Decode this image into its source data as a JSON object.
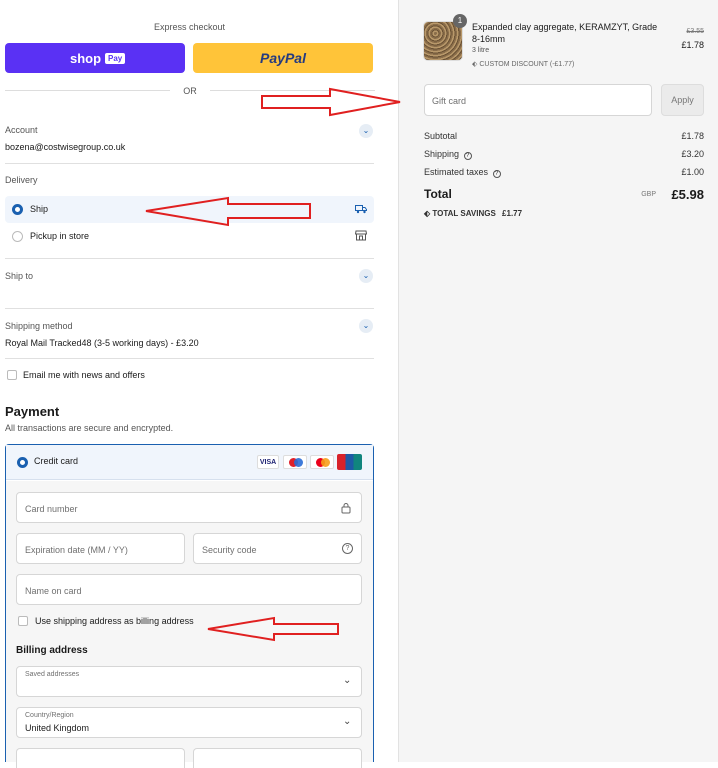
{
  "express": {
    "title": "Express checkout",
    "shop_label": "shop",
    "shop_badge": "Pay",
    "paypal_label": "PayPal",
    "or": "OR"
  },
  "account": {
    "label": "Account",
    "email": "bozena@costwisegroup.co.uk"
  },
  "delivery": {
    "label": "Delivery",
    "options": [
      {
        "label": "Ship",
        "selected": true
      },
      {
        "label": "Pickup in store",
        "selected": false
      }
    ]
  },
  "ship_to": {
    "label": "Ship to"
  },
  "shipping_method": {
    "label": "Shipping method",
    "value": "Royal Mail Tracked48 (3-5 working days) - £3.20"
  },
  "newsletter": {
    "label": "Email me with news and offers"
  },
  "payment": {
    "title": "Payment",
    "subtitle": "All transactions are secure and encrypted.",
    "method": "Credit card",
    "card_brands": [
      "VISA",
      "Maestro",
      "Mastercard",
      "UnionPay"
    ],
    "card_number_ph": "Card number",
    "expiry_ph": "Expiration date (MM / YY)",
    "security_ph": "Security code",
    "name_ph": "Name on card",
    "use_shipping_label": "Use shipping address as billing address"
  },
  "billing": {
    "title": "Billing address",
    "saved_label": "Saved addresses",
    "country_label": "Country/Region",
    "country_value": "United Kingdom"
  },
  "order": {
    "qty_badge": "1",
    "product_name": "Expanded clay aggregate, KERAMZYT, Grade 8-16mm",
    "variant": "3 litre",
    "discount_label": "CUSTOM DISCOUNT (-£1.77)",
    "original_price": "£3.55",
    "price": "£1.78"
  },
  "gift": {
    "placeholder": "Gift card",
    "apply": "Apply"
  },
  "summary": {
    "subtotal_label": "Subtotal",
    "subtotal": "£1.78",
    "shipping_label": "Shipping",
    "shipping": "£3.20",
    "taxes_label": "Estimated taxes",
    "taxes": "£1.00",
    "total_label": "Total",
    "currency": "GBP",
    "total": "£5.98",
    "savings_label": "TOTAL SAVINGS",
    "savings": "£1.77"
  },
  "colors": {
    "shop": "#5a31f4",
    "paypal": "#ffc439",
    "accent": "#1a60b0",
    "arrow": "#e02020"
  }
}
